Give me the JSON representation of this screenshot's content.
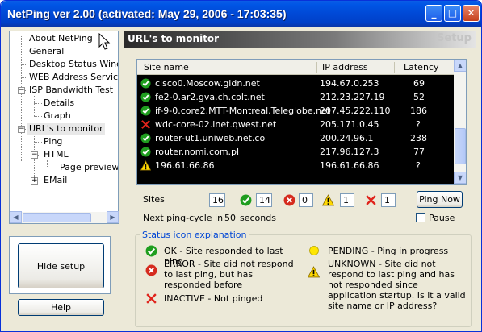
{
  "window": {
    "title": "NetPing ver 2.00 (activated: May 29, 2006 - 17:03:35)",
    "minimize": "_",
    "maximize": "□",
    "close": "✕"
  },
  "tree": {
    "items": [
      {
        "label": "About NetPing"
      },
      {
        "label": "General"
      },
      {
        "label": "Desktop Status Window"
      },
      {
        "label": "WEB Address Service"
      },
      {
        "label": "ISP Bandwidth Test"
      },
      {
        "label": "Details"
      },
      {
        "label": "Graph"
      },
      {
        "label": "URL's to monitor"
      },
      {
        "label": "Ping"
      },
      {
        "label": "HTML"
      },
      {
        "label": "Page preview"
      },
      {
        "label": "EMail"
      }
    ]
  },
  "buttons": {
    "hide_setup": "Hide setup",
    "help": "Help",
    "ping_now": "Ping Now"
  },
  "panel": {
    "title": "URL's to monitor",
    "setup": "Setup"
  },
  "table": {
    "columns": [
      "Site name",
      "IP address",
      "Latency"
    ],
    "rows": [
      {
        "status": "ok",
        "site": "cisco0.Moscow.gldn.net",
        "ip": "194.67.0.253",
        "latency": "69"
      },
      {
        "status": "ok",
        "site": "fe2-0.ar2.gva.ch.colt.net",
        "ip": "212.23.227.19",
        "latency": "52"
      },
      {
        "status": "ok",
        "site": "if-9-0.core2.MTT-Montreal.Teleglobe.net",
        "ip": "207.45.222.110",
        "latency": "186"
      },
      {
        "status": "inactive",
        "site": "wdc-core-02.inet.qwest.net",
        "ip": "205.171.0.45",
        "latency": "?"
      },
      {
        "status": "ok",
        "site": "router-ut1.uniweb.net.co",
        "ip": "200.24.96.1",
        "latency": "238"
      },
      {
        "status": "ok",
        "site": "router.nomi.com.pl",
        "ip": "217.96.127.3",
        "latency": "77"
      },
      {
        "status": "unknown",
        "site": "196.61.66.86",
        "ip": "196.61.66.86",
        "latency": "?"
      }
    ]
  },
  "stats": {
    "sites_label": "Sites",
    "sites": "16",
    "ok": "14",
    "error": "0",
    "unknown": "1",
    "inactive": "1"
  },
  "cycle": {
    "label": "Next ping-cycle in",
    "value": "50",
    "unit": "seconds"
  },
  "pause_label": "Pause",
  "legend": {
    "title": "Status icon explanation",
    "ok": "OK - Site responded to last ping",
    "error": "ERROR - Site did not respond to last ping, but has responded before",
    "inactive": "INACTIVE - Not pinged",
    "pending": "PENDING - Ping in progress",
    "unknown": "UNKNOWN - Site did not respond to last ping and has not responded since application startup. Is it a valid site name or IP address?"
  },
  "colors": {
    "ok": "#1f9e1f",
    "error": "#d52b1e",
    "warning": "#ffd800",
    "pending": "#ffe600",
    "accent": "#0046d5"
  }
}
